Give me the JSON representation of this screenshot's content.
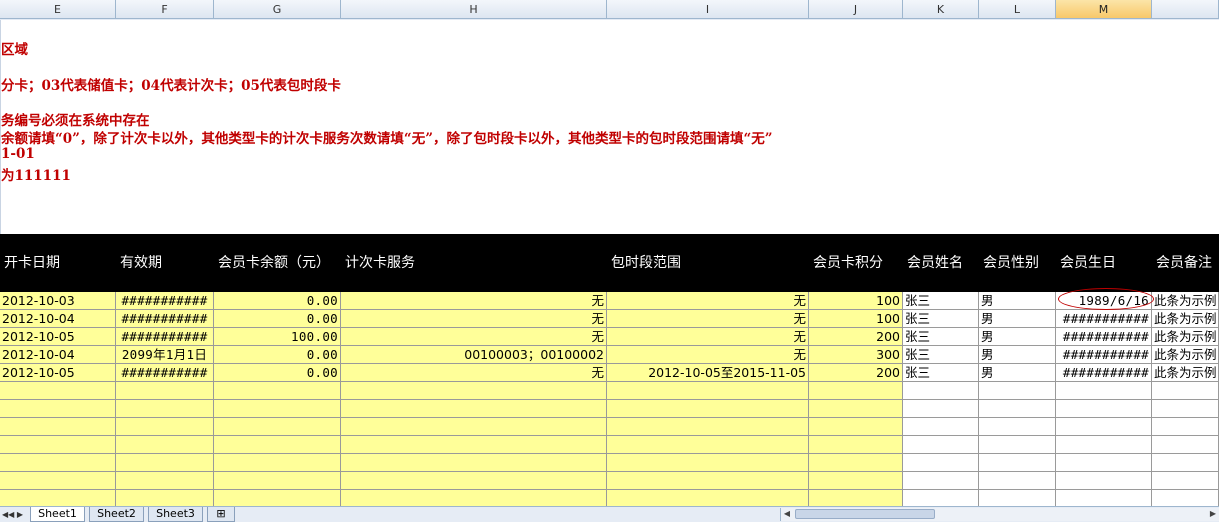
{
  "columns": [
    "E",
    "F",
    "G",
    "H",
    "I",
    "J",
    "K",
    "L",
    "M"
  ],
  "selected_column": "M",
  "notes": [
    "区域",
    "分卡；03代表储值卡；04代表计次卡；05代表包时段卡",
    "务编号必须在系统中存在",
    "余额请填“0”，除了计次卡以外，其他类型卡的计次卡服务次数请填“无”，除了包时段卡以外，其他类型卡的包时段范围请填“无”",
    "1-01",
    "为111111"
  ],
  "header": [
    "开卡日期",
    "有效期",
    "会员卡余额（元）",
    "计次卡服务",
    "包时段范围",
    "会员卡积分",
    "会员姓名",
    "会员性别",
    "会员生日",
    "会员备注"
  ],
  "rows": [
    [
      "2012-10-03",
      "###########",
      "0.00",
      "无",
      "无",
      "100",
      "张三",
      "男",
      "1989/6/16",
      "此条为示例"
    ],
    [
      "2012-10-04",
      "###########",
      "0.00",
      "无",
      "无",
      "100",
      "张三",
      "男",
      "###########",
      "此条为示例"
    ],
    [
      "2012-10-05",
      "###########",
      "100.00",
      "无",
      "无",
      "200",
      "张三",
      "男",
      "###########",
      "此条为示例"
    ],
    [
      "2012-10-04",
      "2099年1月1日",
      "0.00",
      "00100003；00100002",
      "无",
      "300",
      "张三",
      "男",
      "###########",
      "此条为示例"
    ],
    [
      "2012-10-05",
      "###########",
      "0.00",
      "无",
      "2012-10-05至2015-11-05",
      "200",
      "张三",
      "男",
      "###########",
      "此条为示例"
    ]
  ],
  "sheet_tabs": [
    "Sheet1",
    "Sheet2",
    "Sheet3"
  ],
  "active_sheet": "Sheet1",
  "colors": {
    "header_bg": "#000000",
    "note_text": "#c00000",
    "fill_yellow": "#ffff99"
  }
}
